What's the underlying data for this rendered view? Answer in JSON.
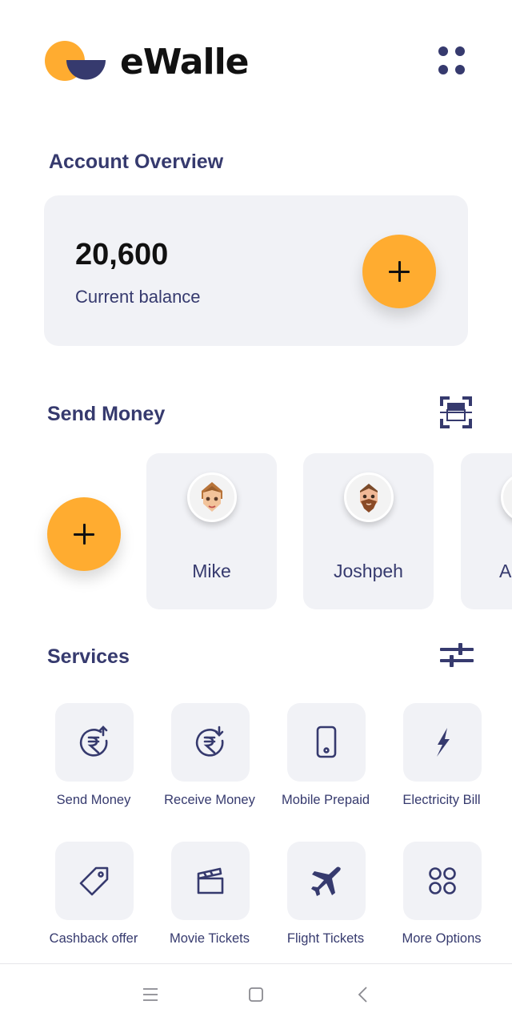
{
  "app": {
    "name": "eWalle",
    "brand_colors": {
      "accent": "#ffac30",
      "primary": "#363a6e"
    }
  },
  "account": {
    "title": "Account Overview",
    "balance": "20,600",
    "balance_label": "Current balance"
  },
  "send_money": {
    "title": "Send Money",
    "contacts": [
      {
        "name": "Mike",
        "icon": "avatar-female-icon"
      },
      {
        "name": "Joshpeh",
        "icon": "avatar-bearded-man-icon"
      },
      {
        "name": "As",
        "icon": "avatar-icon"
      }
    ]
  },
  "services": {
    "title": "Services",
    "items": [
      {
        "label": "Send Money",
        "icon": "rupee-send-icon"
      },
      {
        "label": "Receive Money",
        "icon": "rupee-receive-icon"
      },
      {
        "label": "Mobile Prepaid",
        "icon": "mobile-phone-icon"
      },
      {
        "label": "Electricity Bill",
        "icon": "lightning-icon"
      },
      {
        "label": "Cashback offer",
        "icon": "tag-icon"
      },
      {
        "label": "Movie Tickets",
        "icon": "clapperboard-icon"
      },
      {
        "label": "Flight Tickets",
        "icon": "airplane-icon"
      },
      {
        "label": "More Options",
        "icon": "four-circles-icon"
      }
    ]
  },
  "system_nav": [
    "menu-icon",
    "home-square-icon",
    "back-chevron-icon"
  ]
}
